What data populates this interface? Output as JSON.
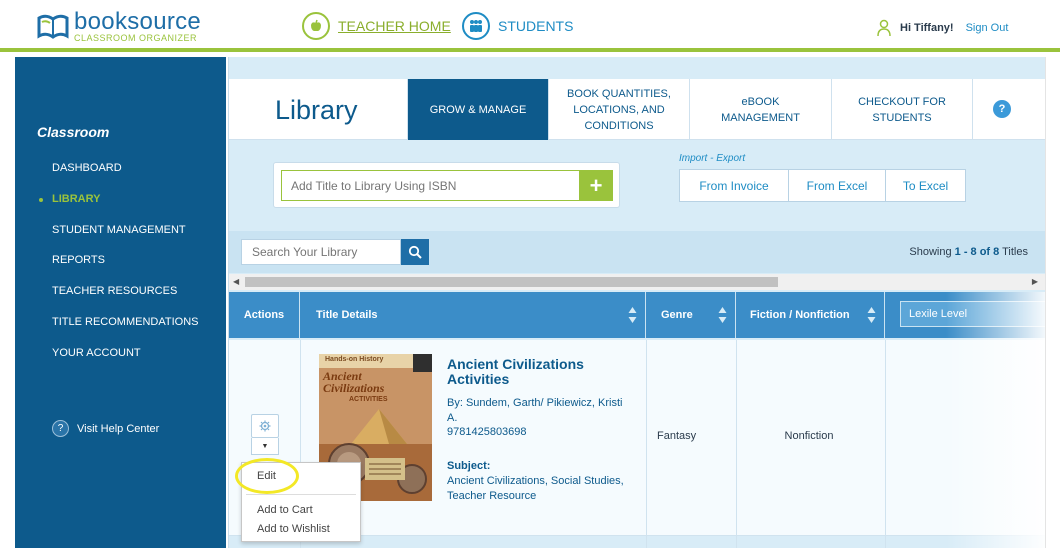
{
  "header": {
    "logo_main": "booksource",
    "logo_sub": "CLASSROOM ORGANIZER",
    "nav_teacher": "TEACHER HOME",
    "nav_students": "STUDENTS",
    "greeting": "Hi Tiffany!",
    "signout": "Sign Out"
  },
  "sidebar": {
    "heading": "Classroom",
    "items": [
      {
        "label": "DASHBOARD"
      },
      {
        "label": "LIBRARY"
      },
      {
        "label": "STUDENT MANAGEMENT"
      },
      {
        "label": "REPORTS"
      },
      {
        "label": "TEACHER RESOURCES"
      },
      {
        "label": "TITLE RECOMMENDATIONS"
      },
      {
        "label": "YOUR ACCOUNT"
      }
    ],
    "help": "Visit Help Center"
  },
  "main": {
    "title": "Library",
    "tabs": [
      {
        "label": "GROW & MANAGE"
      },
      {
        "label": "BOOK QUANTITIES, LOCATIONS, AND CONDITIONS"
      },
      {
        "label": "eBOOK MANAGEMENT"
      },
      {
        "label": "CHECKOUT FOR STUDENTS"
      }
    ],
    "help_glyph": "?",
    "isbn_placeholder": "Add Title to Library Using ISBN",
    "import_export_label": "Import - Export",
    "import_buttons": [
      "From Invoice",
      "From Excel",
      "To Excel"
    ],
    "search_placeholder": "Search Your Library",
    "showing_prefix": "Showing ",
    "showing_range": "1 - 8 of 8",
    "showing_suffix": " Titles"
  },
  "table": {
    "columns": [
      "Actions",
      "Title Details",
      "Genre",
      "Fiction / Nonfiction",
      "Lexile Level"
    ],
    "rows": [
      {
        "cover_top": "Hands-on History",
        "cover_title": "Ancient Civilizations",
        "cover_sub": "ACTIVITIES",
        "title": "Ancient Civilizations Activities",
        "author": "By: Sundem, Garth/ Pikiewicz, Kristi A.",
        "isbn": "9781425803698",
        "subject_label": "Subject:",
        "subject": "Ancient Civilizations, Social Studies, Teacher Resource",
        "genre": "Fantasy",
        "fiction": "Nonfiction"
      }
    ]
  },
  "action_menu": {
    "edit": "Edit",
    "add_cart": "Add to Cart",
    "add_wishlist": "Add to Wishlist"
  },
  "colors": {
    "primary": "#0d5a8c",
    "accent_green": "#9ac33c",
    "header_blue": "#3b8dc8",
    "highlight": "#f3e826"
  }
}
